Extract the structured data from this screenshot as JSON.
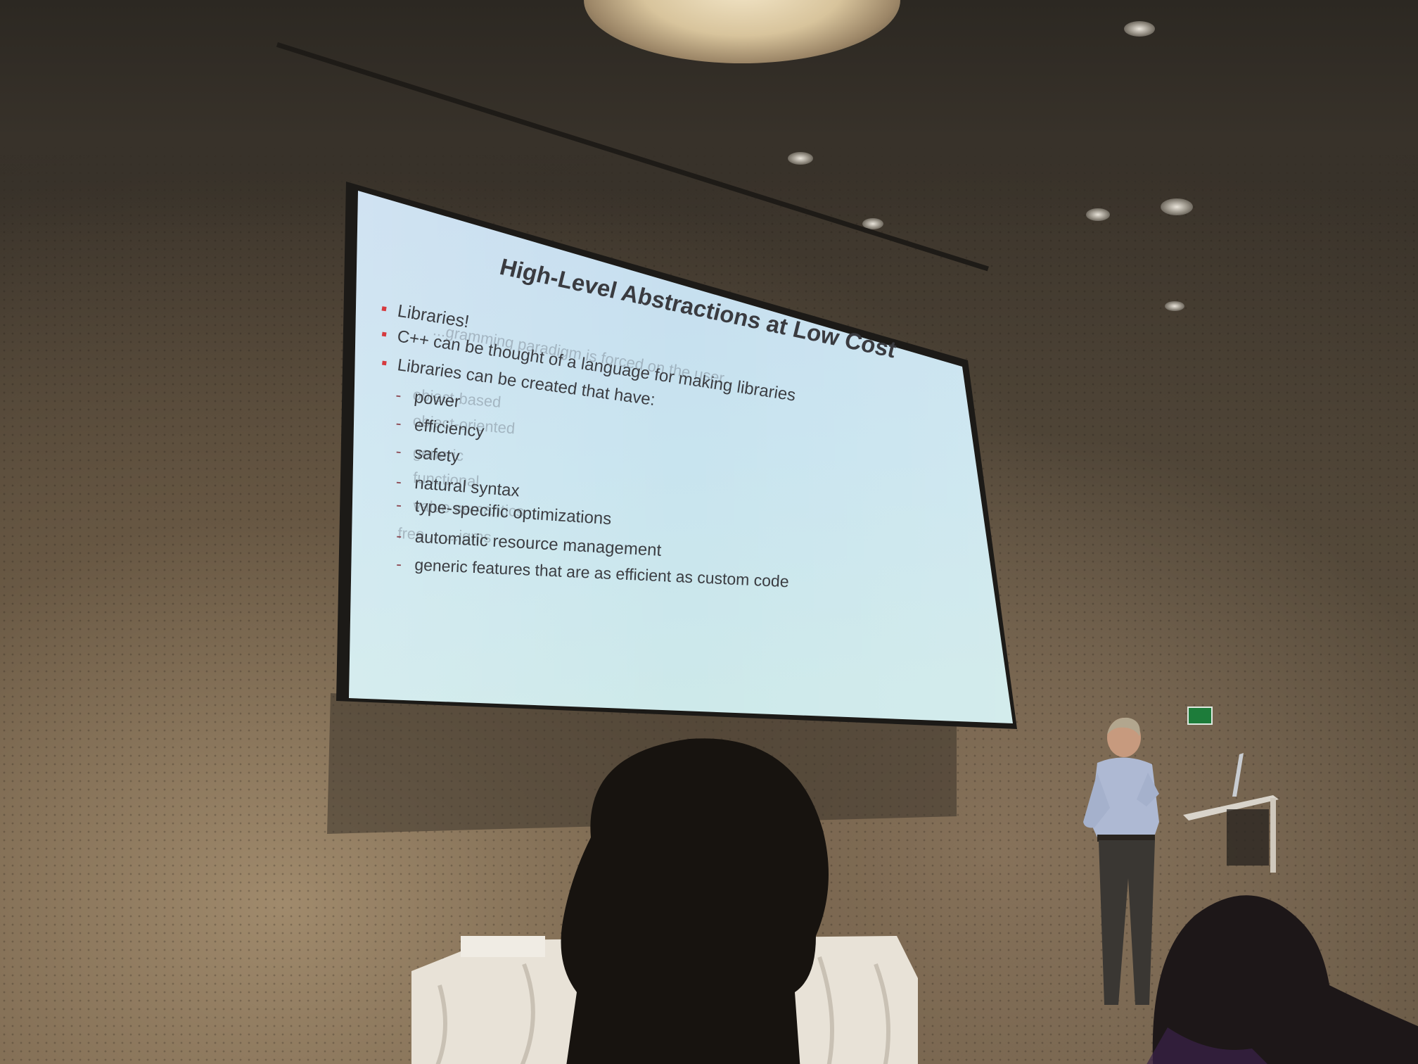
{
  "slide": {
    "title": "High-Level Abstractions at Low Cost",
    "bullets": [
      {
        "text": "Libraries!",
        "level": 1
      },
      {
        "text": "C++ can be thought of a language for making libraries",
        "level": 1
      },
      {
        "text": "Libraries can be created that have:",
        "level": 1
      },
      {
        "text": "power",
        "level": 2
      },
      {
        "text": "efficiency",
        "level": 2
      },
      {
        "text": "safety",
        "level": 2
      },
      {
        "text": "natural syntax",
        "level": 2
      },
      {
        "text": "type-specific optimizations",
        "level": 2
      },
      {
        "text": "automatic resource management",
        "level": 2
      },
      {
        "text": "generic features that are as efficient as custom code",
        "level": 2
      }
    ],
    "ghost_text": {
      "line1": "...gramming paradigm is forced on the user.",
      "line2": "object-based",
      "line3": "object-oriented",
      "line4": "generic",
      "line5": "functional",
      "line6": "value semantics",
      "line7": "free ... ...igms"
    },
    "colors": {
      "background_top": "#c9dff0",
      "background_bottom": "#cbe8ec",
      "text": "#3b3d42",
      "bullet_marker": "#d63a3f"
    }
  },
  "scene": {
    "exit_sign_icon": "emergency-exit-icon"
  }
}
